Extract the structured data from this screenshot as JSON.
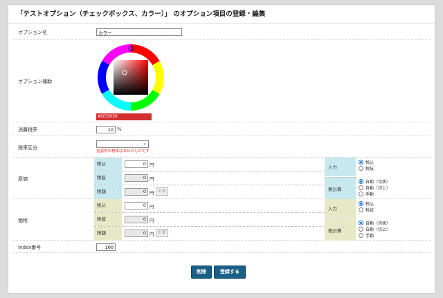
{
  "title": "「テストオプション（チェックボックス、カラー）」 のオプション項目の登録・編集",
  "option_name": {
    "label": "オプション名",
    "value": "カラー"
  },
  "option_aux": {
    "label": "オプション補助",
    "color_hex": "#D53030",
    "color_value": "#d53030"
  },
  "tax_rate": {
    "label": "消費税率",
    "value": "10",
    "unit": "%"
  },
  "tax_category": {
    "label": "税率区分",
    "selected": "",
    "note": "括弧内の税率は本日のものです"
  },
  "cost": {
    "label": "原価",
    "rows": [
      {
        "label": "税込",
        "value": "0",
        "unit": "円"
      },
      {
        "label": "税抜",
        "value": "0",
        "unit": "円"
      },
      {
        "label": "税額",
        "value": "0",
        "unit": "円",
        "calc": "計算"
      }
    ],
    "input_label": "入力",
    "input_options": [
      "税込",
      "税抜"
    ],
    "calc_label": "税計算",
    "calc_options": [
      "自動（切捨）",
      "自動（切上）",
      "手動"
    ]
  },
  "price": {
    "label": "価格",
    "rows": [
      {
        "label": "税込",
        "value": "0",
        "unit": "円"
      },
      {
        "label": "税抜",
        "value": "0",
        "unit": "円"
      },
      {
        "label": "税額",
        "value": "0",
        "unit": "円",
        "calc": "計算"
      }
    ],
    "input_label": "入力",
    "input_options": [
      "税込",
      "税抜"
    ],
    "calc_label": "税計算",
    "calc_options": [
      "自動（切捨）",
      "自動（切上）",
      "手動"
    ]
  },
  "index": {
    "label": "Index番号",
    "value": "100"
  },
  "buttons": {
    "delete": "削除",
    "register": "登録する"
  }
}
